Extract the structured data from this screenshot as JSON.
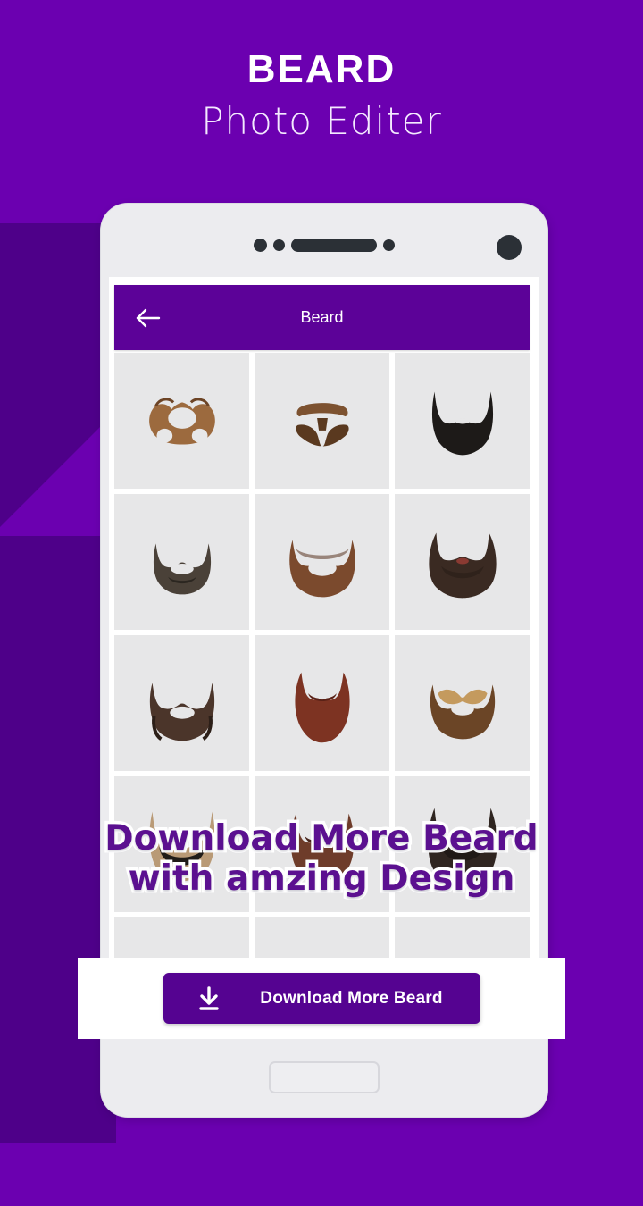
{
  "promo": {
    "title_main": "BEARD",
    "title_sub": "Photo Editer",
    "overlay_line1": "Download More Beard",
    "overlay_line2": "with amzing Design",
    "background_color": "#6B00B0",
    "shadow_color": "#4E0089"
  },
  "app": {
    "appbar": {
      "title": "Beard",
      "back_icon": "arrow-left-icon",
      "color": "#5C0298"
    },
    "grid": {
      "columns": 3,
      "cell_color": "#e7e7e8",
      "items": [
        {
          "id": 1,
          "label": "beard-style-1",
          "color": "#9c6a3e",
          "accent": "#6d4425",
          "shape": "handlebar-mustache-goatee"
        },
        {
          "id": 2,
          "label": "beard-style-2",
          "color": "#7d5230",
          "accent": "#5a391f",
          "shape": "mustache-chin-strap"
        },
        {
          "id": 3,
          "label": "beard-style-3",
          "color": "#1d1a18",
          "accent": "#0d0c0b",
          "shape": "full-black-beard"
        },
        {
          "id": 4,
          "label": "beard-style-4",
          "color": "#4a4138",
          "accent": "#2b2620",
          "shape": "short-dark-beard"
        },
        {
          "id": 5,
          "label": "beard-style-5",
          "color": "#7b4a2d",
          "accent": "#5a3420",
          "shape": "round-brown-beard"
        },
        {
          "id": 6,
          "label": "beard-style-6",
          "color": "#3a2a22",
          "accent": "#241a14",
          "shape": "bushy-dark-beard"
        },
        {
          "id": 7,
          "label": "beard-style-7",
          "color": "#4b352a",
          "accent": "#2c1f18",
          "shape": "wavy-dark-brown-beard"
        },
        {
          "id": 8,
          "label": "beard-style-8",
          "color": "#7d3322",
          "accent": "#5a2116",
          "shape": "auburn-viking-beard"
        },
        {
          "id": 9,
          "label": "beard-style-9",
          "color": "#6b4526",
          "accent": "#c49a5e",
          "shape": "brown-beard-blonde-mustache"
        },
        {
          "id": 10,
          "label": "beard-style-10",
          "color": "#b99a76",
          "accent": "#201c18",
          "shape": "grey-blonde-beard"
        },
        {
          "id": 11,
          "label": "beard-style-11",
          "color": "#6e3c2a",
          "accent": "#47241a",
          "shape": "red-brown-beard"
        },
        {
          "id": 12,
          "label": "beard-style-12",
          "color": "#2f2520",
          "accent": "#181310",
          "shape": "long-dark-beard"
        },
        {
          "id": 13,
          "label": "beard-style-13",
          "color": "#d8d8d9",
          "accent": "#c9c9cb",
          "shape": "partial-row"
        },
        {
          "id": 14,
          "label": "beard-style-14",
          "color": "#d8d8d9",
          "accent": "#c9c9cb",
          "shape": "partial-row"
        },
        {
          "id": 15,
          "label": "beard-style-15",
          "color": "#d8d8d9",
          "accent": "#c9c9cb",
          "shape": "partial-row"
        }
      ]
    },
    "cta": {
      "label": "Download More Beard",
      "icon": "download-icon",
      "color": "#550391"
    },
    "device": {
      "speaker_icon": "speaker-grille-icon",
      "camera_icon": "front-camera-icon",
      "home_button": "home-button"
    }
  }
}
